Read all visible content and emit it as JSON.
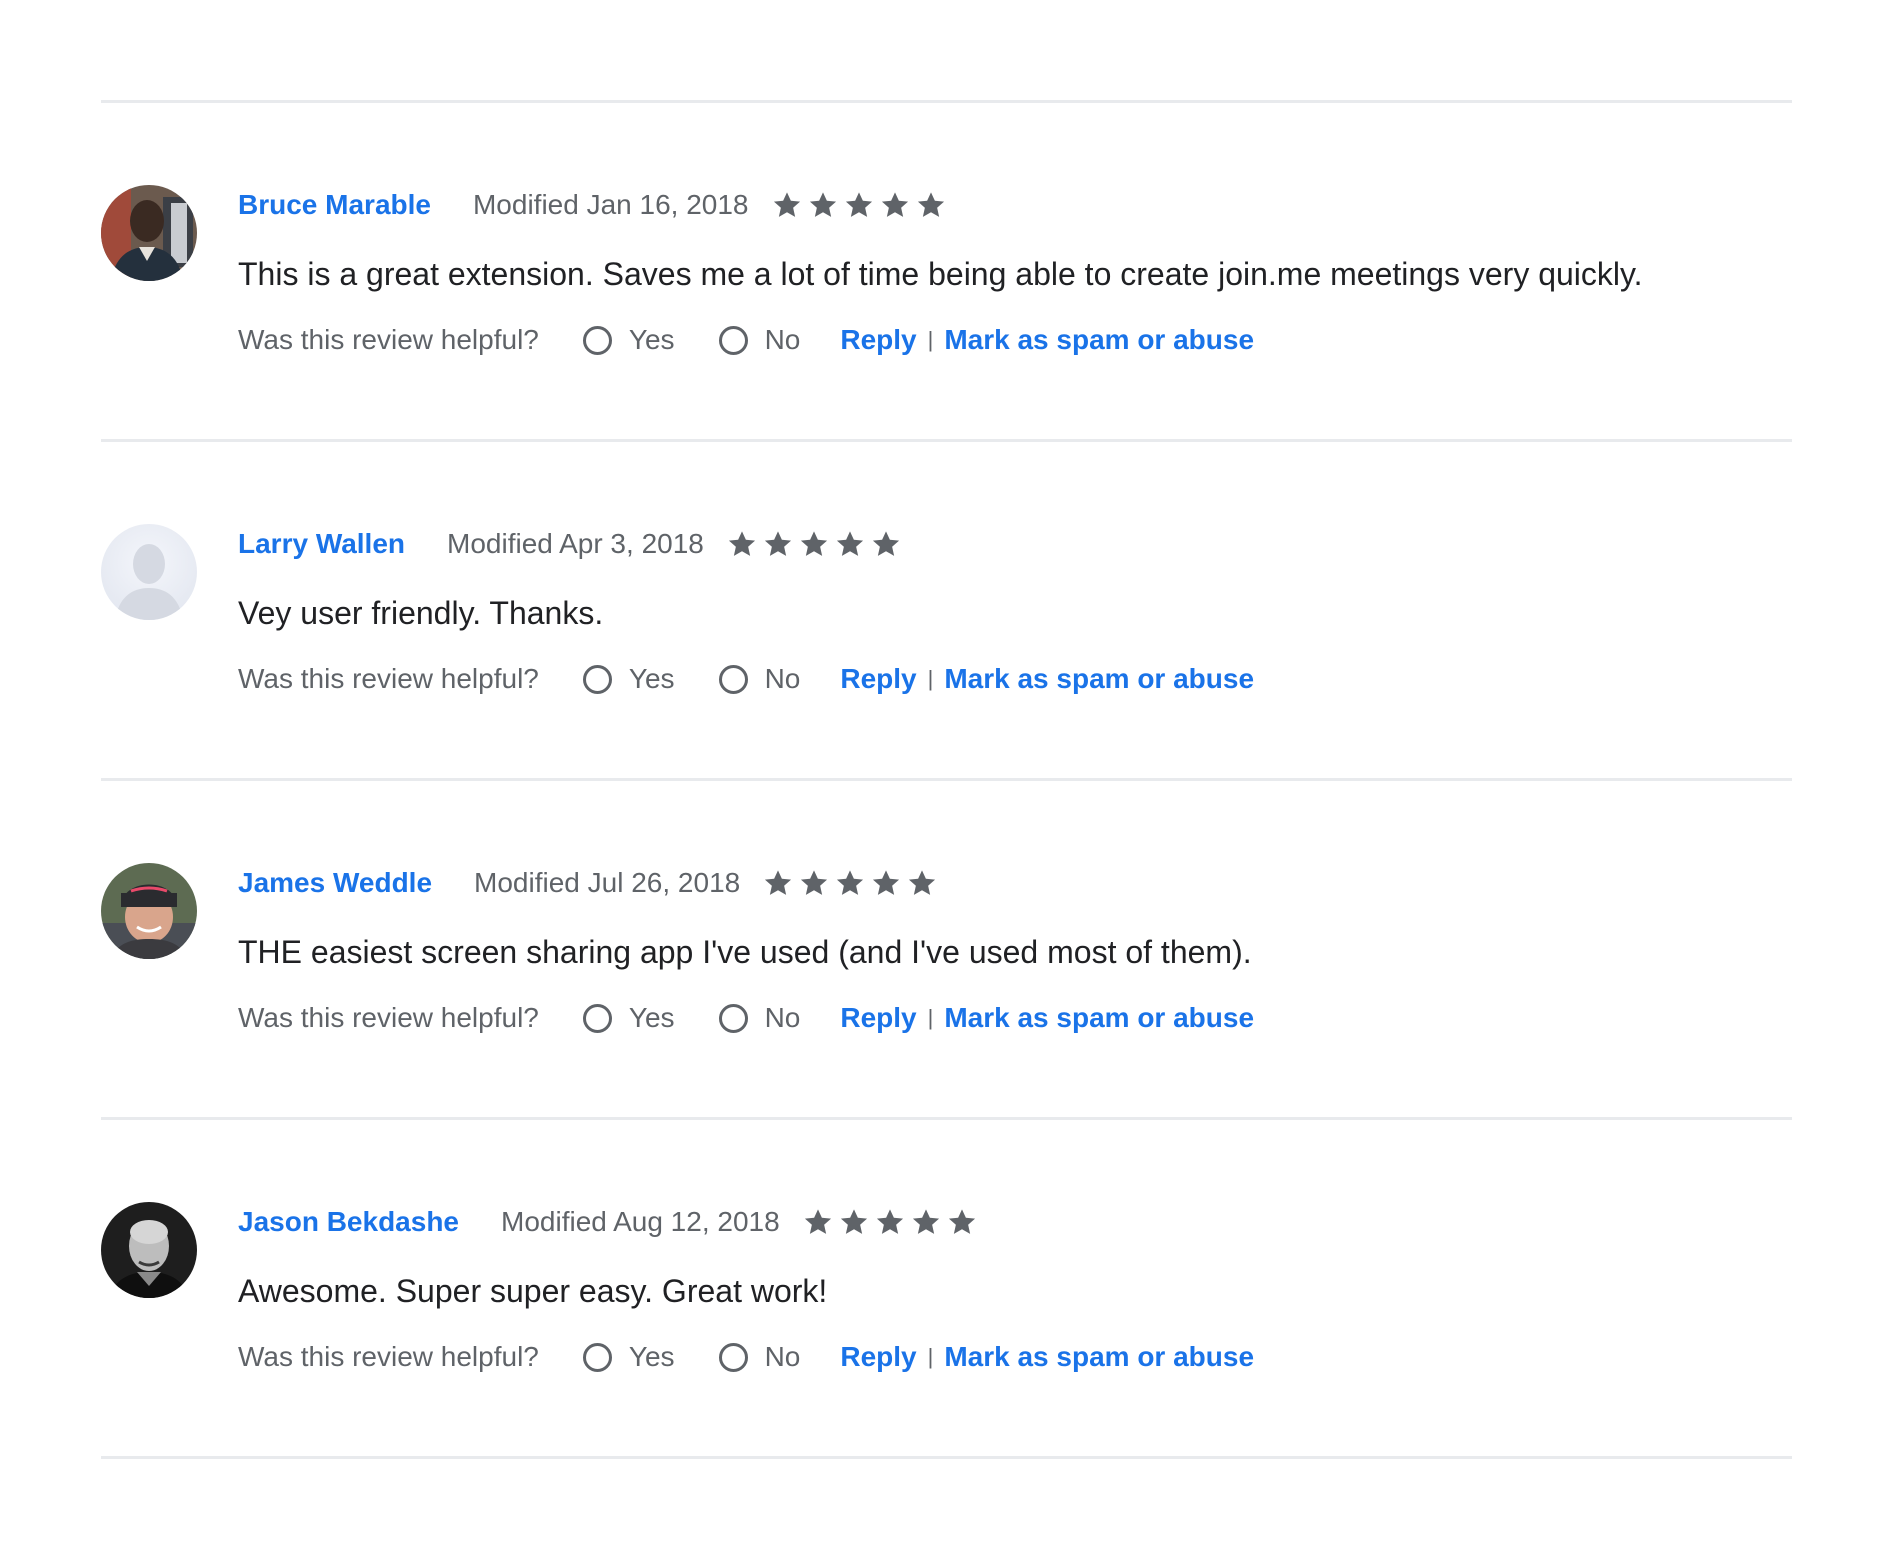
{
  "colors": {
    "link": "#1a73e8",
    "secondary_text": "#5f6368",
    "body_text": "#202124",
    "divider": "#e8eaed",
    "star": "#5f6368"
  },
  "reviews": [
    {
      "author": "Bruce Marable",
      "date": "Modified Jan 16, 2018",
      "rating": 5,
      "text": "This is a great extension. Saves me a lot of time being able to create join.me meetings very quickly.",
      "helpful_question": "Was this review helpful?",
      "yes_label": "Yes",
      "no_label": "No",
      "reply_label": "Reply",
      "separator": "|",
      "spam_label": "Mark as spam or abuse",
      "avatar_icon": "user-photo-icon"
    },
    {
      "author": "Larry Wallen",
      "date": "Modified Apr 3, 2018",
      "rating": 5,
      "text": "Vey user friendly. Thanks.",
      "helpful_question": "Was this review helpful?",
      "yes_label": "Yes",
      "no_label": "No",
      "reply_label": "Reply",
      "separator": "|",
      "spam_label": "Mark as spam or abuse",
      "avatar_icon": "default-user-silhouette-icon"
    },
    {
      "author": "James Weddle",
      "date": "Modified Jul 26, 2018",
      "rating": 5,
      "text": "THE easiest screen sharing app I've used (and I've used most of them).",
      "helpful_question": "Was this review helpful?",
      "yes_label": "Yes",
      "no_label": "No",
      "reply_label": "Reply",
      "separator": "|",
      "spam_label": "Mark as spam or abuse",
      "avatar_icon": "user-photo-icon"
    },
    {
      "author": "Jason Bekdashe",
      "date": "Modified Aug 12, 2018",
      "rating": 5,
      "text": "Awesome. Super super easy. Great work!",
      "helpful_question": "Was this review helpful?",
      "yes_label": "Yes",
      "no_label": "No",
      "reply_label": "Reply",
      "separator": "|",
      "spam_label": "Mark as spam or abuse",
      "avatar_icon": "user-photo-icon"
    }
  ]
}
